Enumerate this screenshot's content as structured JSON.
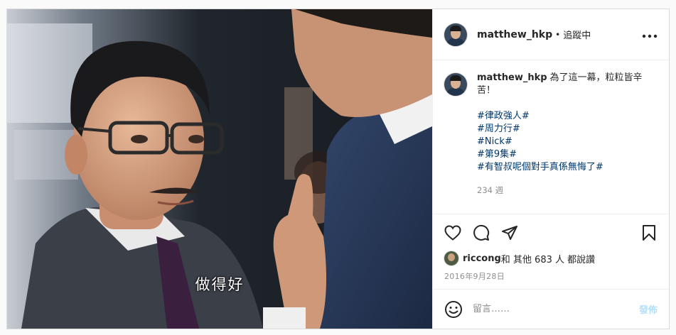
{
  "post": {
    "media": {
      "subtitle": "做得好"
    },
    "header": {
      "username": "matthew_hkp",
      "separator": "•",
      "follow_status": "追蹤中",
      "more_icon": "more-horizontal-icon"
    },
    "caption": {
      "username": "matthew_hkp",
      "text": "為了這一幕，粒粒皆辛苦！",
      "hashtags": [
        "#律政強人#",
        "#周力行#",
        "#Nick#",
        "#第9集#",
        "#有智叔呢個對手真係無悔了#"
      ],
      "age": "234 週"
    },
    "actions": {
      "like_icon": "heart-icon",
      "comment_icon": "comment-icon",
      "share_icon": "paper-plane-icon",
      "save_icon": "bookmark-icon"
    },
    "likes": {
      "user": "riccong",
      "rest": " 和 其他 683 人 都說讚"
    },
    "date": "2016年9月28日",
    "add_comment": {
      "placeholder": "留言……",
      "post_label": "發佈",
      "emoji_icon": "smiley-icon"
    }
  },
  "colors": {
    "link": "#00376b",
    "muted": "#8e8e8e",
    "post_button_disabled": "#b2dffc",
    "border": "#dbdbdb"
  }
}
